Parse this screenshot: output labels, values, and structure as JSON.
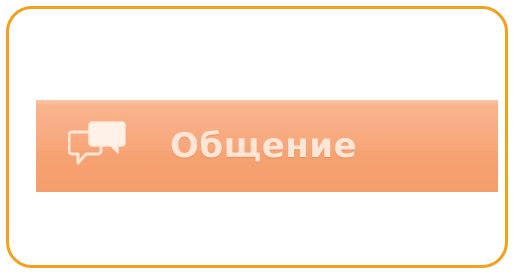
{
  "colors": {
    "frame_border": "#f5a01a",
    "button_bg": "#f7a678",
    "label_text": "#fde6d5"
  },
  "button": {
    "label": "Общение",
    "icon": "chat-bubbles-icon"
  }
}
